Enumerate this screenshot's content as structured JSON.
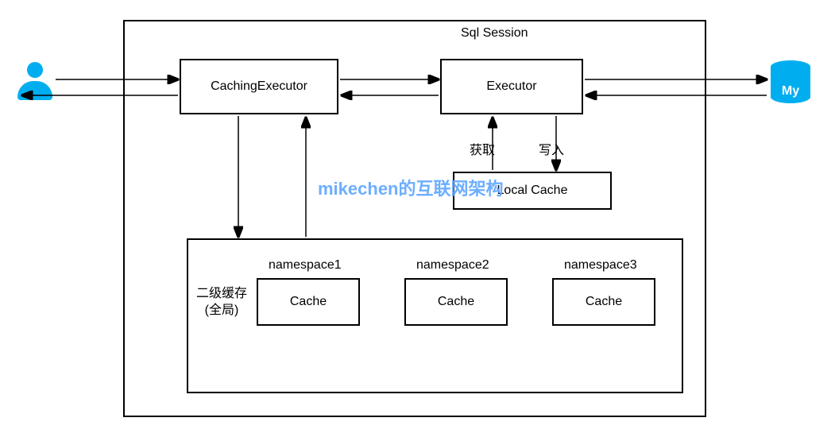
{
  "session_label": "Sql Session",
  "caching_executor": "CachingExecutor",
  "executor": "Executor",
  "local_cache": "Local Cache",
  "fetch_label": "获取",
  "write_label": "写入",
  "l2_cache_label_line1": "二级缓存",
  "l2_cache_label_line2": "(全局)",
  "ns1_label": "namespace1",
  "ns2_label": "namespace2",
  "ns3_label": "namespace3",
  "cache_label": "Cache",
  "db_short": "My",
  "watermark": "mikechen的互联网架构"
}
